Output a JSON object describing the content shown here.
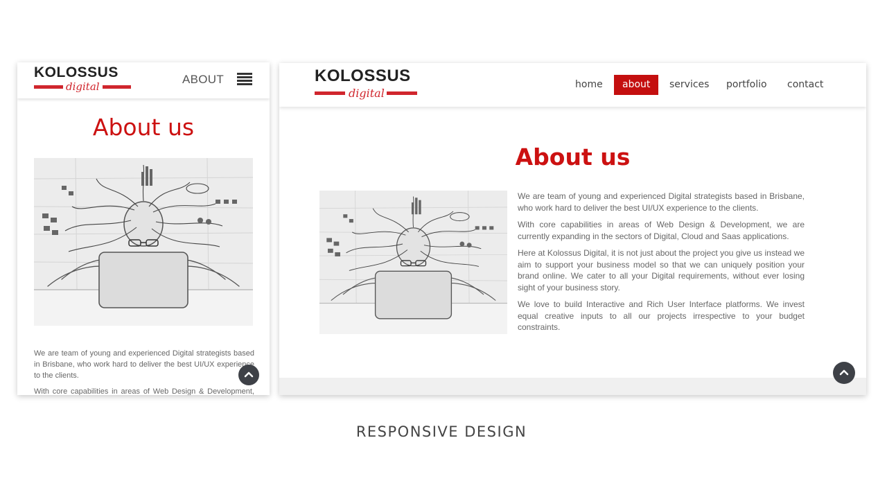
{
  "brand": {
    "name": "KOLOSSUS",
    "tagline": "digital",
    "accent_color": "#d0262d"
  },
  "mobile": {
    "section_label": "ABOUT",
    "menu_icon": "hamburger-icon",
    "page_title": "About us",
    "illustration": "sketch-man-with-laptop",
    "paragraphs": [
      "We are team of young and experienced Digital strategists based in Brisbane, who work hard to deliver the best UI/UX experience to the clients.",
      "With core capabilities in areas of Web Design & Development, we are currently expanding in the sectors of Digital, Cloud and Saas applications."
    ],
    "scroll_top_icon": "chevron-up-icon"
  },
  "desktop": {
    "nav": [
      {
        "label": "home",
        "active": false
      },
      {
        "label": "about",
        "active": true
      },
      {
        "label": "services",
        "active": false
      },
      {
        "label": "portfolio",
        "active": false
      },
      {
        "label": "contact",
        "active": false
      }
    ],
    "page_title": "About us",
    "illustration": "sketch-man-with-laptop",
    "paragraphs": [
      "We are team of young and experienced Digital strategists based in Brisbane, who work hard to deliver the best UI/UX experience to the clients.",
      "With core capabilities in areas of Web Design & Development, we are currently expanding in the sectors of Digital, Cloud and Saas applications.",
      "Here at Kolossus Digital, it is not just about the project you give us instead we aim to support your business model so that we can uniquely position your brand online. We cater to all your Digital requirements, without ever losing sight of your business story.",
      "We love to build Interactive and Rich User Interface platforms. We invest equal creative inputs to all our projects irrespective to your budget constraints."
    ],
    "scroll_top_icon": "chevron-up-icon"
  },
  "caption": "RESPONSIVE DESIGN",
  "colors": {
    "title_red": "#cc1111",
    "nav_active_bg": "#c40f0f",
    "scroll_button": "#3e4147"
  }
}
